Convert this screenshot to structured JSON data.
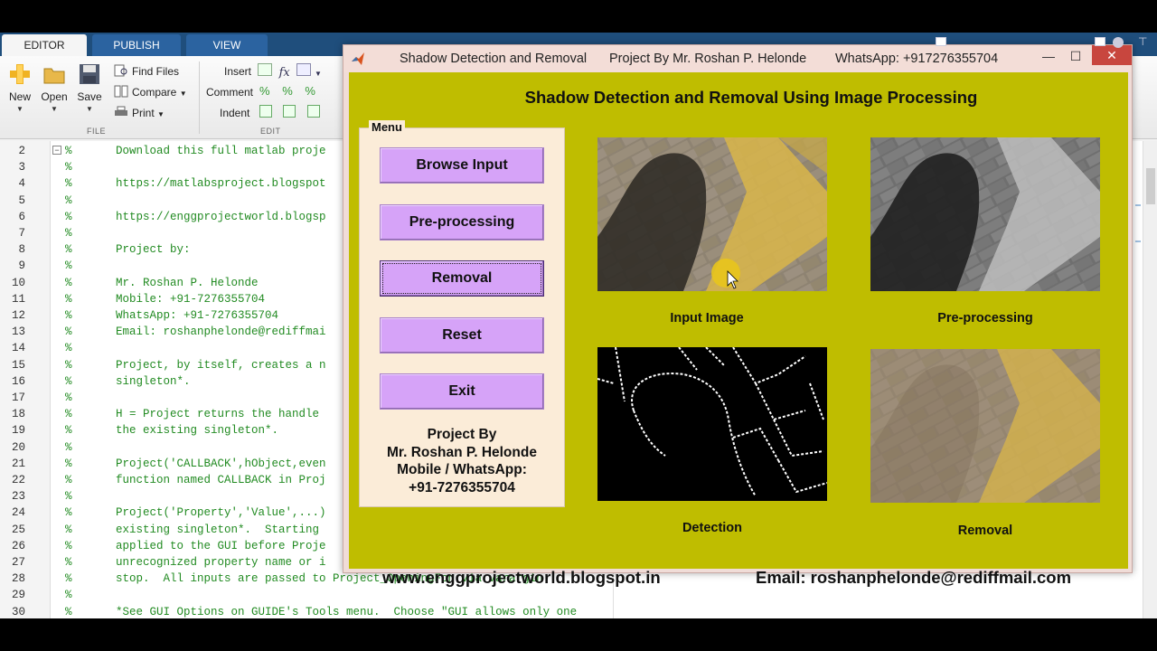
{
  "matlab": {
    "tabs": [
      "EDITOR",
      "PUBLISH",
      "VIEW"
    ],
    "toolstrip": {
      "new": "New",
      "open": "Open",
      "save": "Save",
      "find_files": "Find Files",
      "compare": "Compare",
      "print": "Print",
      "insert": "Insert",
      "comment": "Comment",
      "indent": "Indent",
      "section_file": "FILE",
      "section_edit": "EDIT"
    },
    "code_lines": [
      {
        "n": "2",
        "text": "Download this full matlab proje"
      },
      {
        "n": "3",
        "text": ""
      },
      {
        "n": "4",
        "text": "https://matlabsproject.blogspot"
      },
      {
        "n": "5",
        "text": ""
      },
      {
        "n": "6",
        "text": "https://enggprojectworld.blogsp"
      },
      {
        "n": "7",
        "text": ""
      },
      {
        "n": "8",
        "text": "Project by:"
      },
      {
        "n": "9",
        "text": ""
      },
      {
        "n": "10",
        "text": "Mr. Roshan P. Helonde"
      },
      {
        "n": "11",
        "text": "Mobile: +91-7276355704"
      },
      {
        "n": "12",
        "text": "WhatsApp: +91-7276355704"
      },
      {
        "n": "13",
        "text": "Email: roshanphelonde@rediffmai"
      },
      {
        "n": "14",
        "text": ""
      },
      {
        "n": "15",
        "text": "Project, by itself, creates a n"
      },
      {
        "n": "16",
        "text": "singleton*."
      },
      {
        "n": "17",
        "text": ""
      },
      {
        "n": "18",
        "text": "H = Project returns the handle"
      },
      {
        "n": "19",
        "text": "the existing singleton*."
      },
      {
        "n": "20",
        "text": ""
      },
      {
        "n": "21",
        "text": "Project('CALLBACK',hObject,even"
      },
      {
        "n": "22",
        "text": "function named CALLBACK in Proj"
      },
      {
        "n": "23",
        "text": ""
      },
      {
        "n": "24",
        "text": "Project('Property','Value',...)"
      },
      {
        "n": "25",
        "text": "existing singleton*.  Starting"
      },
      {
        "n": "26",
        "text": "applied to the GUI before Proje"
      },
      {
        "n": "27",
        "text": "unrecognized property name or i"
      },
      {
        "n": "28",
        "text": "stop.  All inputs are passed to Project_OpeningFcn via varargin."
      },
      {
        "n": "29",
        "text": ""
      },
      {
        "n": "30",
        "text": "*See GUI Options on GUIDE's Tools menu.  Choose \"GUI allows only one"
      }
    ]
  },
  "gui": {
    "title": {
      "app": "Shadow Detection and Removal",
      "author": "Project By Mr. Roshan P. Helonde",
      "contact": "WhatsApp: +917276355704"
    },
    "window_controls": {
      "minimize": "—",
      "maximize": "☐",
      "close": "✕"
    },
    "heading": "Shadow Detection and Removal Using Image Processing",
    "menu": {
      "title": "Menu",
      "buttons": [
        "Browse Input",
        "Pre-processing",
        "Removal",
        "Reset",
        "Exit"
      ],
      "focused": "Removal",
      "credit": [
        "Project By",
        "Mr. Roshan P. Helonde",
        "Mobile / WhatsApp:",
        "+91-7276355704"
      ]
    },
    "panels": [
      {
        "caption": "Input Image"
      },
      {
        "caption": "Pre-processing"
      },
      {
        "caption": "Detection"
      },
      {
        "caption": "Removal"
      }
    ],
    "footer": {
      "url": "www.enggprojectworld.blogspot.in",
      "email": "Email: roshanphelonde@rediffmail.com"
    },
    "colors": {
      "canvas": "#bfbd00",
      "button": "#d6a3f8",
      "menu_panel": "#fbecd8",
      "close": "#c8463e"
    }
  }
}
